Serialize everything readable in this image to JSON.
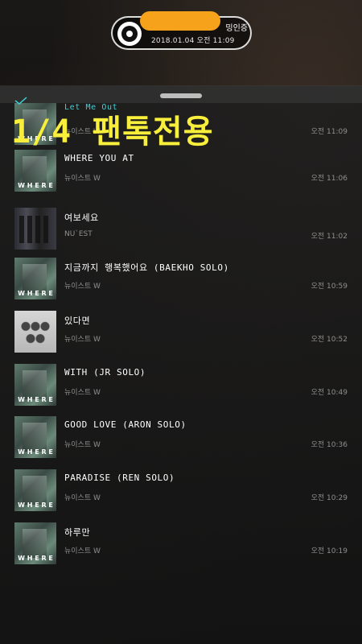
{
  "now_playing": {
    "label_suffix": "밍인증",
    "time": "2018.01.04 오전 11:09"
  },
  "overlay_text": "1/4 팬톡전용",
  "tracks": [
    {
      "title": "Let Me Out",
      "artist": "뉴이스트 W",
      "time": "오전 11:09",
      "cover": "where"
    },
    {
      "title": "WHERE YOU AT",
      "artist": "뉴이스트 W",
      "time": "오전 11:06",
      "cover": "where"
    },
    {
      "title": "여보세요",
      "artist": "NU`EST",
      "time": "오전 11:02",
      "cover": "yeobo"
    },
    {
      "title": "지금까지 행복했어요 (BAEKHO SOLO)",
      "artist": "뉴이스트 W",
      "time": "오전 10:59",
      "cover": "where"
    },
    {
      "title": "있다면",
      "artist": "뉴이스트 W",
      "time": "오전 10:52",
      "cover": "itdamyeon"
    },
    {
      "title": "WITH (JR SOLO)",
      "artist": "뉴이스트 W",
      "time": "오전 10:49",
      "cover": "where"
    },
    {
      "title": "GOOD LOVE (ARON SOLO)",
      "artist": "뉴이스트 W",
      "time": "오전 10:36",
      "cover": "where"
    },
    {
      "title": "PARADISE (REN SOLO)",
      "artist": "뉴이스트 W",
      "time": "오전 10:29",
      "cover": "where"
    },
    {
      "title": "하루만",
      "artist": "뉴이스트 W",
      "time": "오전 10:19",
      "cover": "where"
    }
  ],
  "colors": {
    "accent_cyan": "#3fd0d5",
    "overlay_yellow": "#f7ef3b",
    "redaction_orange": "#f6a21b"
  }
}
